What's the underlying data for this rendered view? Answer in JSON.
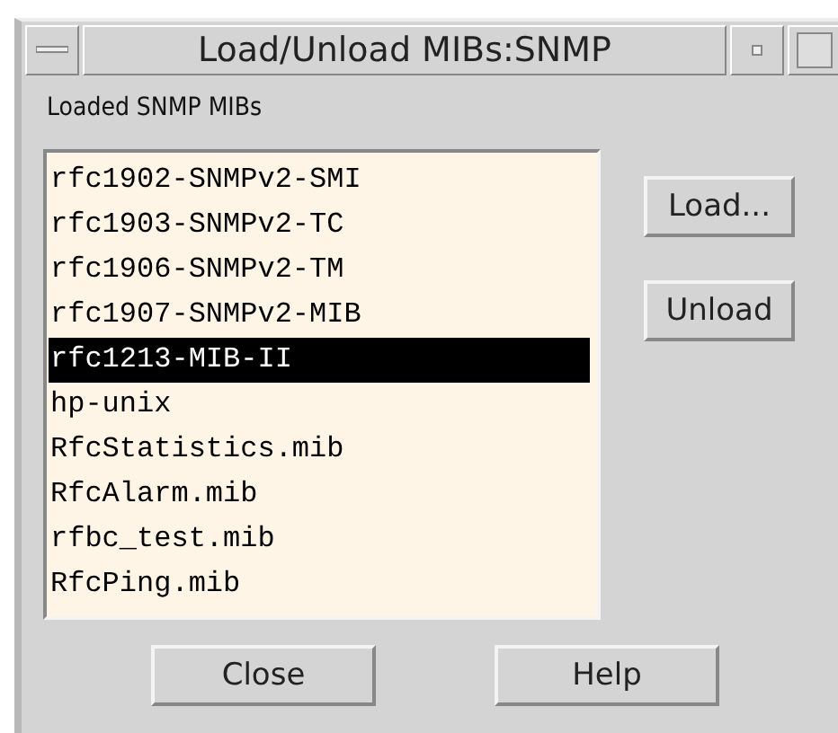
{
  "window": {
    "title": "Load/Unload MIBs:SNMP"
  },
  "list_label": "Loaded SNMP MIBs",
  "mibs": [
    {
      "name": "rfc1902-SNMPv2-SMI",
      "selected": false
    },
    {
      "name": "rfc1903-SNMPv2-TC",
      "selected": false
    },
    {
      "name": "rfc1906-SNMPv2-TM",
      "selected": false
    },
    {
      "name": "rfc1907-SNMPv2-MIB",
      "selected": false
    },
    {
      "name": "rfc1213-MIB-II",
      "selected": true
    },
    {
      "name": "hp-unix",
      "selected": false
    },
    {
      "name": "RfcStatistics.mib",
      "selected": false
    },
    {
      "name": "RfcAlarm.mib",
      "selected": false
    },
    {
      "name": "rfbc_test.mib",
      "selected": false
    },
    {
      "name": "RfcPing.mib",
      "selected": false
    }
  ],
  "side_buttons": [
    "Load...",
    "Unload"
  ],
  "bottom_buttons": [
    "Close",
    "Help"
  ]
}
